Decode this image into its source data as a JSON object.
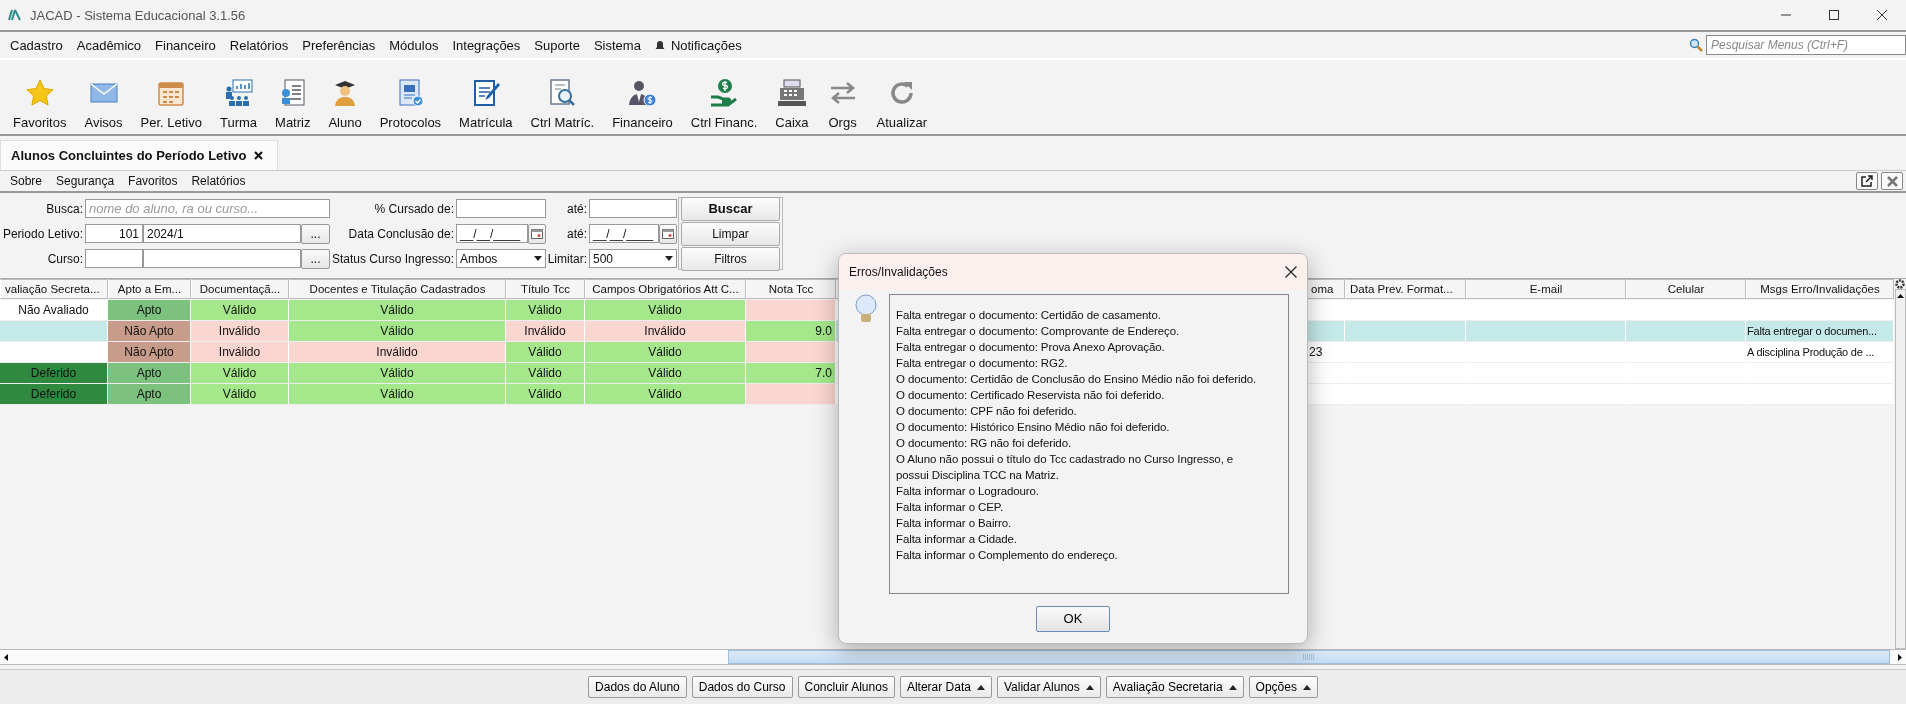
{
  "window": {
    "title": "JACAD - Sistema Educacional 3.1.56"
  },
  "menu": [
    {
      "label": "Cadastro",
      "kind": "menu"
    },
    {
      "label": "Acadêmico",
      "kind": "menu"
    },
    {
      "label": "Financeiro",
      "kind": "menu"
    },
    {
      "label": "Relatórios",
      "kind": "menu"
    },
    {
      "label": "Preferências",
      "kind": "menu"
    },
    {
      "label": "Módulos",
      "kind": "menu"
    },
    {
      "label": "Integrações",
      "kind": "menu"
    },
    {
      "label": "Suporte",
      "kind": "menu"
    },
    {
      "label": "Sistema",
      "kind": "menu"
    },
    {
      "label": "Notificações",
      "kind": "bell"
    }
  ],
  "menu_search": {
    "placeholder": "Pesquisar Menus (Ctrl+F)"
  },
  "toolbar": [
    {
      "label": "Favoritos"
    },
    {
      "label": "Avisos"
    },
    {
      "label": "Per. Letivo"
    },
    {
      "label": "Turma"
    },
    {
      "label": "Matriz"
    },
    {
      "label": "Aluno"
    },
    {
      "label": "Protocolos"
    },
    {
      "label": "Matrícula"
    },
    {
      "label": "Ctrl Matríc."
    },
    {
      "label": "Financeiro"
    },
    {
      "label": "Ctrl Financ."
    },
    {
      "label": "Caixa"
    },
    {
      "label": "Orgs"
    },
    {
      "label": "Atualizar"
    }
  ],
  "tabs": [
    {
      "label": "Alunos Concluintes do Período Letivo",
      "selected": true
    }
  ],
  "submenu": [
    "Sobre",
    "Segurança",
    "Favoritos",
    "Relatórios"
  ],
  "filters": {
    "busca": {
      "label": "Busca:",
      "placeholder": "nome do aluno, ra ou curso..."
    },
    "periodo": {
      "label": "Periodo Letivo:",
      "code": "101",
      "value": "2024/1",
      "button": "..."
    },
    "curso": {
      "label": "Curso:",
      "button": "..."
    },
    "cursado_de": {
      "label": "% Cursado de:"
    },
    "cursado_ate": {
      "label": "até:"
    },
    "conclusao_de": {
      "label": "Data Conclusão de:",
      "value": "__/__/____"
    },
    "conclusao_ate": {
      "label": "até:",
      "value": "__/__/____"
    },
    "status": {
      "label": "Status Curso Ingresso:",
      "value": "Ambos"
    },
    "limitar": {
      "label": "Limitar:",
      "value": "500"
    },
    "buttons": [
      "Buscar",
      "Limpar",
      "Filtros"
    ]
  },
  "table": {
    "columns": [
      "valiação Secreta...",
      "Apto a Em...",
      "Documentaçã...",
      "Docentes e Titulação Cadastrados",
      "Título Tcc",
      "Campos Obrigatórios Att C...",
      "Nota Tcc",
      "oma",
      "Data Prev. Format...",
      "E-mail",
      "Celular",
      "Msgs Erro/Invalidações"
    ],
    "rows": [
      {
        "selected": false,
        "cells": [
          {
            "text": "Não Avaliado",
            "kind": "plain"
          },
          {
            "text": "Apto",
            "kind": "apto"
          },
          {
            "text": "Válido",
            "kind": "valido"
          },
          {
            "text": "Válido",
            "kind": "valido"
          },
          {
            "text": "Válido",
            "kind": "valido"
          },
          {
            "text": "Válido",
            "kind": "valido"
          },
          {
            "kind": "invalido"
          },
          {
            "kind": "plain"
          },
          {
            "kind": "plain"
          },
          {
            "kind": "plain"
          },
          {
            "kind": "plain"
          },
          {
            "kind": "plain"
          }
        ]
      },
      {
        "selected": true,
        "cells": [
          {
            "kind": "plain"
          },
          {
            "text": "Não Apto",
            "kind": "nao_apto"
          },
          {
            "text": "Inválido",
            "kind": "invalido"
          },
          {
            "text": "Válido",
            "kind": "valido"
          },
          {
            "text": "Inválido",
            "kind": "invalido"
          },
          {
            "text": "Inválido",
            "kind": "invalido"
          },
          {
            "text": "9.0",
            "kind": "valido"
          },
          {
            "kind": "plain"
          },
          {
            "kind": "plain"
          },
          {
            "kind": "plain"
          },
          {
            "kind": "plain"
          },
          {
            "text": "Falta entregar o documen...",
            "kind": "plain"
          }
        ]
      },
      {
        "selected": false,
        "cells": [
          {
            "kind": "plain"
          },
          {
            "text": "Não Apto",
            "kind": "nao_apto"
          },
          {
            "text": "Inválido",
            "kind": "invalido"
          },
          {
            "text": "Inválido",
            "kind": "invalido"
          },
          {
            "text": "Válido",
            "kind": "valido"
          },
          {
            "text": "Válido",
            "kind": "valido"
          },
          {
            "kind": "invalido"
          },
          {
            "text": "23",
            "kind": "plain"
          },
          {
            "kind": "plain"
          },
          {
            "kind": "plain"
          },
          {
            "kind": "plain"
          },
          {
            "text": "A disciplina Produção de ...",
            "kind": "plain"
          }
        ]
      },
      {
        "selected": false,
        "cells": [
          {
            "text": "Deferido",
            "kind": "deferido"
          },
          {
            "text": "Apto",
            "kind": "apto"
          },
          {
            "text": "Válido",
            "kind": "valido"
          },
          {
            "text": "Válido",
            "kind": "valido"
          },
          {
            "text": "Válido",
            "kind": "valido"
          },
          {
            "text": "Válido",
            "kind": "valido"
          },
          {
            "text": "7.0",
            "kind": "valido"
          },
          {
            "kind": "plain"
          },
          {
            "kind": "plain"
          },
          {
            "kind": "plain"
          },
          {
            "kind": "plain"
          },
          {
            "kind": "plain"
          }
        ]
      },
      {
        "selected": false,
        "cells": [
          {
            "text": "Deferido",
            "kind": "deferido"
          },
          {
            "text": "Apto",
            "kind": "apto"
          },
          {
            "text": "Válido",
            "kind": "valido"
          },
          {
            "text": "Válido",
            "kind": "valido"
          },
          {
            "text": "Válido",
            "kind": "valido"
          },
          {
            "text": "Válido",
            "kind": "valido"
          },
          {
            "kind": "invalido"
          },
          {
            "kind": "plain"
          },
          {
            "kind": "plain"
          },
          {
            "kind": "plain"
          },
          {
            "kind": "plain"
          },
          {
            "kind": "plain"
          }
        ]
      }
    ]
  },
  "footer": [
    {
      "label": "Dados do Aluno",
      "menu": false
    },
    {
      "label": "Dados do Curso",
      "menu": false
    },
    {
      "label": "Concluir Alunos",
      "menu": false
    },
    {
      "label": "Alterar Data",
      "menu": true
    },
    {
      "label": "Validar Alunos",
      "menu": true
    },
    {
      "label": "Avaliação Secretaria",
      "menu": true
    },
    {
      "label": "Opções",
      "menu": true
    }
  ],
  "dialog": {
    "title": "Erros/Invalidações",
    "messages": [
      "Falta entregar o documento: Certidão de casamento.",
      "Falta entregar o documento: Comprovante de Endereço.",
      "Falta entregar o documento: Prova Anexo Aprovação.",
      "Falta entregar o documento: RG2.",
      "O documento: Certidão de Conclusão do Ensino Médio não foi deferido.",
      "O documento: Certificado Reservista não foi deferido.",
      "O documento: CPF não foi deferido.",
      "O documento: Histórico Ensino Médio não foi deferido.",
      "O documento: RG não foi deferido.",
      "O Aluno não possui o título do Tcc cadastrado no Curso Ingresso, e possui Disciplina TCC na Matriz.",
      "Falta informar o Logradouro.",
      "Falta informar o CEP.",
      "Falta informar o Bairro.",
      "Falta informar a Cidade.",
      "Falta informar o Complemento do endereço."
    ],
    "button": "OK"
  }
}
